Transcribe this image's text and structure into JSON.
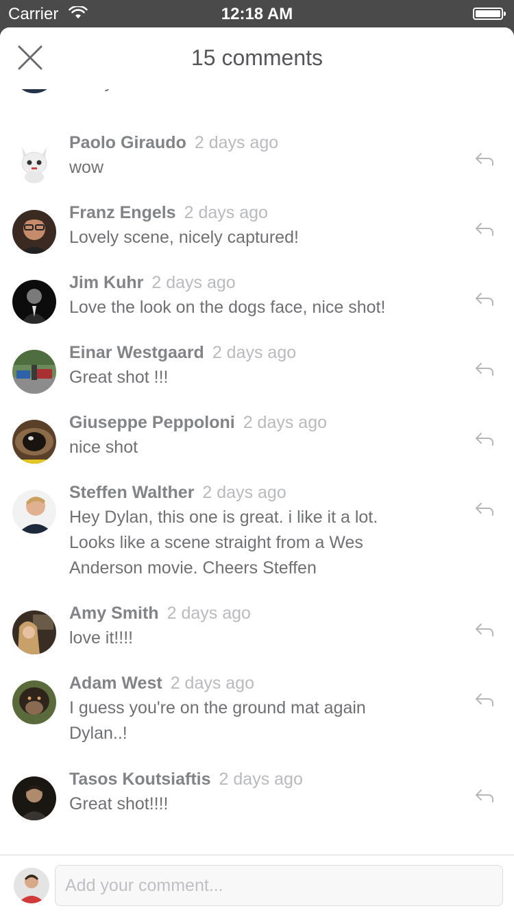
{
  "status_bar": {
    "carrier": "Carrier",
    "time": "12:18 AM"
  },
  "header": {
    "title": "15 comments"
  },
  "partial_comment": {
    "text": "lovely"
  },
  "comments": [
    {
      "author": "Paolo Giraudo",
      "time": "2 days ago",
      "text": "wow"
    },
    {
      "author": "Franz Engels",
      "time": "2 days ago",
      "text": "Lovely scene, nicely captured!"
    },
    {
      "author": "Jim Kuhr",
      "time": "2 days ago",
      "text": "Love the look on the dogs face, nice shot!"
    },
    {
      "author": "Einar Westgaard",
      "time": "2 days ago",
      "text": "Great shot !!!"
    },
    {
      "author": "Giuseppe  Peppoloni",
      "time": "2 days ago",
      "text": "nice shot"
    },
    {
      "author": "Steffen Walther",
      "time": "2 days ago",
      "text": "Hey Dylan, this one is great. i like it a lot. Looks like a scene straight from a Wes Anderson movie. Cheers Steffen"
    },
    {
      "author": "Amy Smith",
      "time": "2 days ago",
      "text": "love it!!!!"
    },
    {
      "author": "Adam West",
      "time": "2 days ago",
      "text": "I guess you're on the ground mat again Dylan..!"
    },
    {
      "author": "Tasos Koutsiaftis",
      "time": "2 days ago",
      "text": "Great shot!!!!"
    }
  ],
  "composer": {
    "placeholder": "Add your comment..."
  },
  "colors": {
    "status_bar": "#4a4a4a",
    "author": "#828387",
    "timestamp": "#b9babd",
    "text": "#6f7073"
  }
}
